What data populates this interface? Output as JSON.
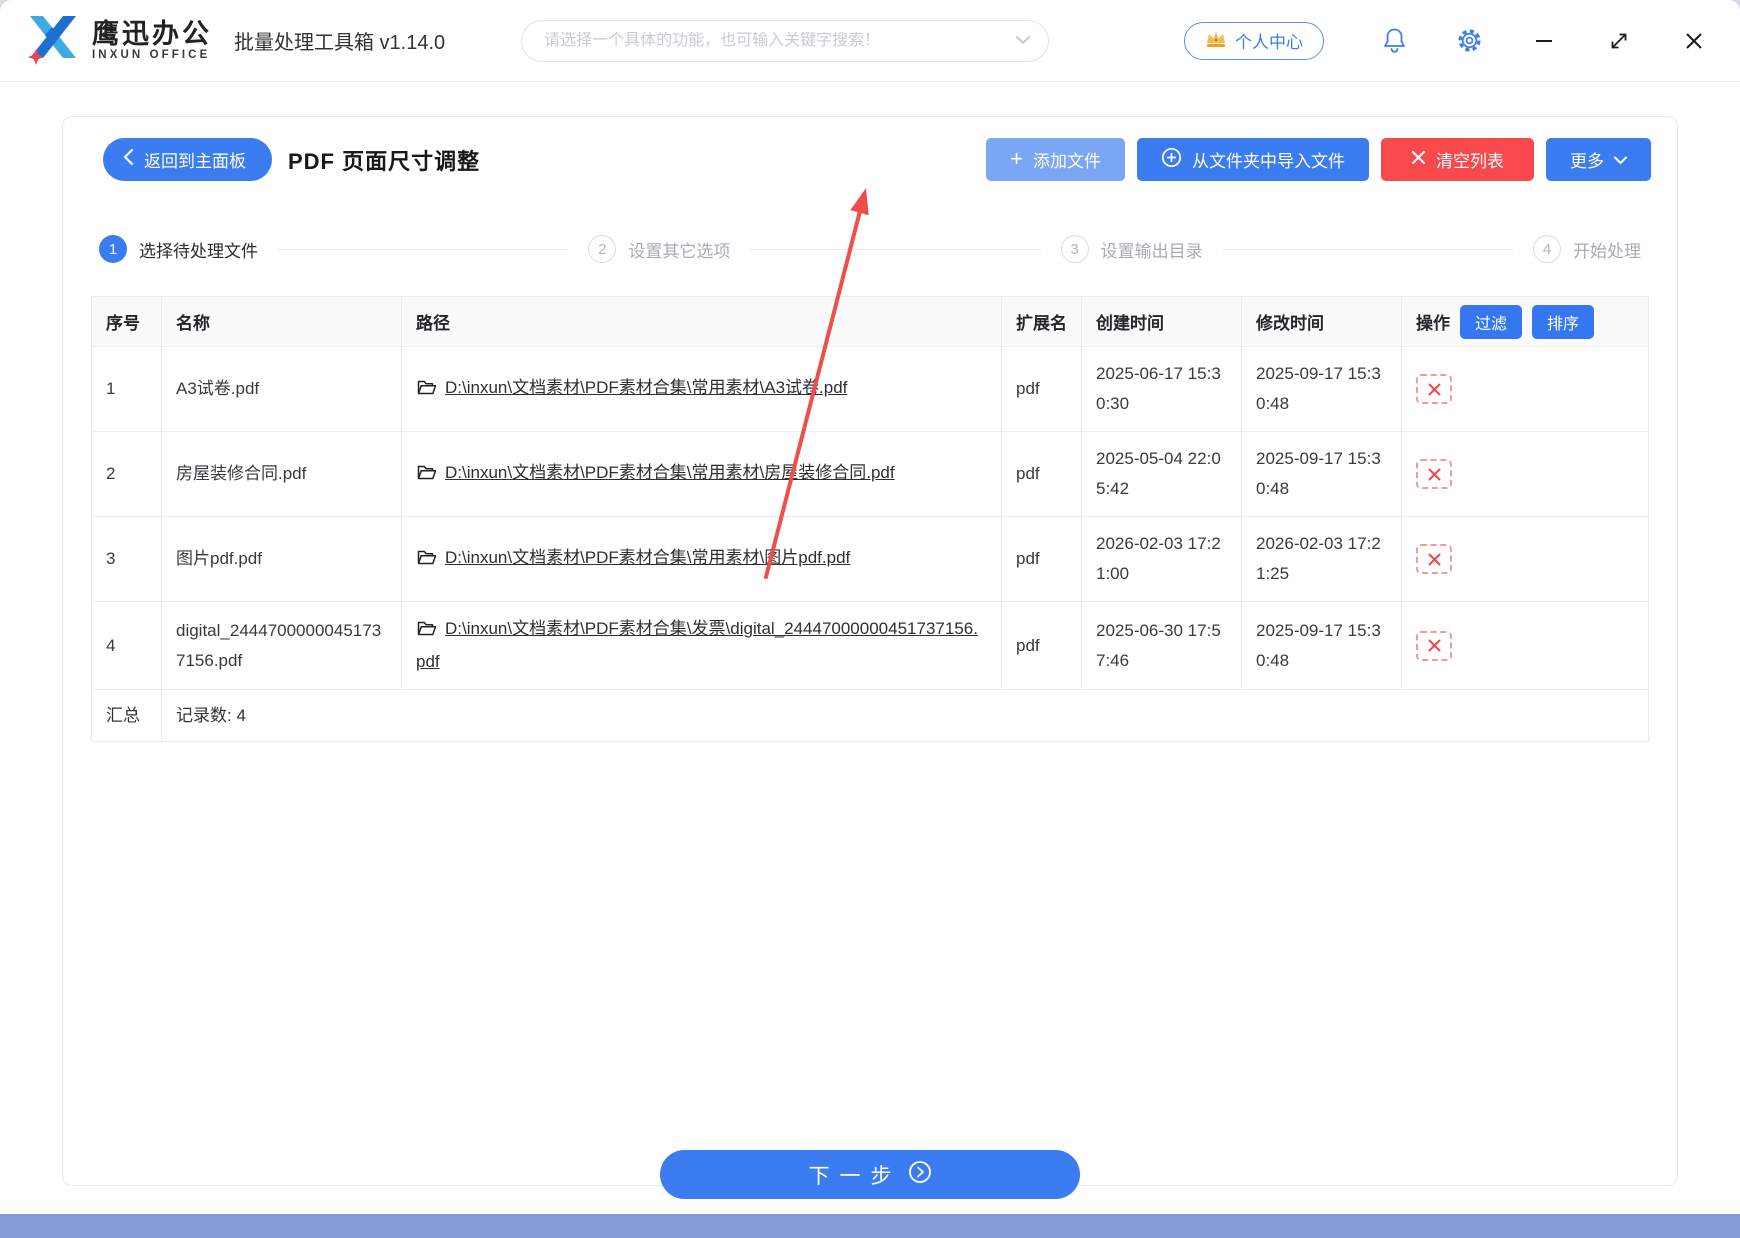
{
  "topbar": {
    "logo_cn": "鹰迅办公",
    "logo_en": "INXUN OFFICE",
    "app_title": "批量处理工具箱 v1.14.0",
    "search_placeholder": "请选择一个具体的功能，也可输入关键字搜索！",
    "personal_center": "个人中心"
  },
  "header": {
    "back_label": "返回到主面板",
    "page_title": "PDF 页面尺寸调整",
    "add_files": "添加文件",
    "import_folder": "从文件夹中导入文件",
    "clear_list": "清空列表",
    "more": "更多"
  },
  "steps": [
    {
      "num": "1",
      "label": "选择待处理文件"
    },
    {
      "num": "2",
      "label": "设置其它选项"
    },
    {
      "num": "3",
      "label": "设置输出目录"
    },
    {
      "num": "4",
      "label": "开始处理"
    }
  ],
  "table": {
    "headers": {
      "index": "序号",
      "name": "名称",
      "path": "路径",
      "ext": "扩展名",
      "created": "创建时间",
      "modified": "修改时间",
      "actions": "操作",
      "filter": "过滤",
      "sort": "排序"
    },
    "rows": [
      {
        "index": "1",
        "name": "A3试卷.pdf",
        "path": "D:\\inxun\\文档素材\\PDF素材合集\\常用素材\\A3试卷.pdf",
        "ext": "pdf",
        "created": "2025-06-17 15:30:30",
        "modified": "2025-09-17 15:30:48"
      },
      {
        "index": "2",
        "name": "房屋装修合同.pdf",
        "path": "D:\\inxun\\文档素材\\PDF素材合集\\常用素材\\房屋装修合同.pdf",
        "ext": "pdf",
        "created": "2025-05-04 22:05:42",
        "modified": "2025-09-17 15:30:48"
      },
      {
        "index": "3",
        "name": "图片pdf.pdf",
        "path": "D:\\inxun\\文档素材\\PDF素材合集\\常用素材\\图片pdf.pdf",
        "ext": "pdf",
        "created": "2026-02-03 17:21:00",
        "modified": "2026-02-03 17:21:25"
      },
      {
        "index": "4",
        "name": "digital_24447000000451737156.pdf",
        "path": "D:\\inxun\\文档素材\\PDF素材合集\\发票\\digital_24447000000451737156.pdf",
        "ext": "pdf",
        "created": "2025-06-30 17:57:46",
        "modified": "2025-09-17 15:30:48"
      }
    ],
    "summary_label": "汇总",
    "summary_count_label": "记录数: 4"
  },
  "footer": {
    "next_label": "下一步"
  },
  "colors": {
    "primary_blue": "#3b7cf0",
    "light_blue_button": "#7aa6f4",
    "danger_red": "#f8494c",
    "arrow_red": "#ef4e4b",
    "link_text": "#2f2f31",
    "bottom_strip": "#849dd6"
  }
}
